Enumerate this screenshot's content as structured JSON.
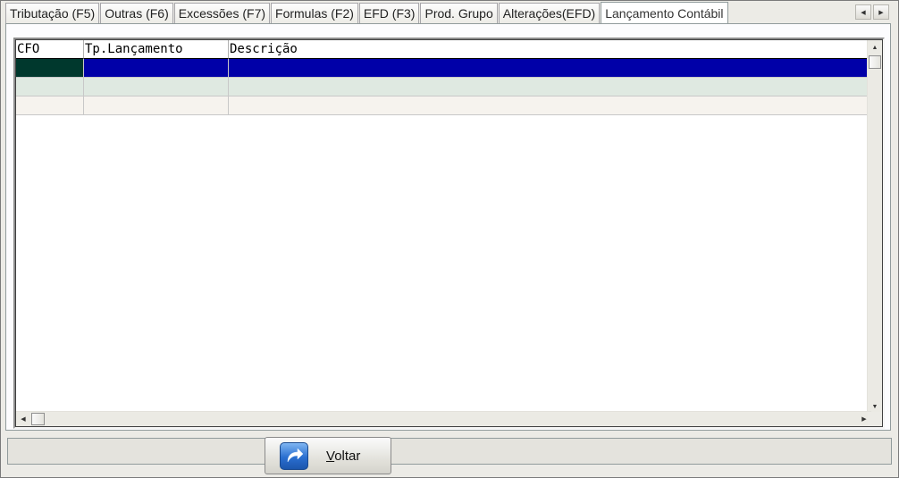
{
  "tabs": [
    {
      "label": "Tributação (F5)",
      "active": false
    },
    {
      "label": "Outras (F6)",
      "active": false
    },
    {
      "label": "Excessões (F7)",
      "active": false
    },
    {
      "label": "Formulas (F2)",
      "active": false
    },
    {
      "label": "EFD (F3)",
      "active": false
    },
    {
      "label": "Prod. Grupo",
      "active": false
    },
    {
      "label": "Alterações(EFD)",
      "active": false
    },
    {
      "label": "Lançamento Contábil",
      "active": true
    }
  ],
  "tab_scroll": {
    "left_icon": "arrow-left-icon",
    "right_icon": "arrow-right-icon"
  },
  "grid": {
    "columns": [
      "CFO",
      "Tp.Lançamento",
      "Descrição"
    ],
    "rows": [
      {
        "cfo": "",
        "tp_lancamento": "",
        "descricao": "",
        "state": "selected"
      },
      {
        "cfo": "",
        "tp_lancamento": "",
        "descricao": "",
        "state": "normal"
      },
      {
        "cfo": "",
        "tp_lancamento": "",
        "descricao": "",
        "state": "normal"
      }
    ],
    "colors": {
      "selected": "#0000a8",
      "selected_first_cell": "#00382d",
      "row_alt_1": "#dfe9e1",
      "row_alt_2": "#f6f3ee"
    }
  },
  "footer": {
    "voltar_button": {
      "label_mnemonic": "V",
      "label_rest": "oltar",
      "icon": "return-arrow-icon"
    }
  }
}
